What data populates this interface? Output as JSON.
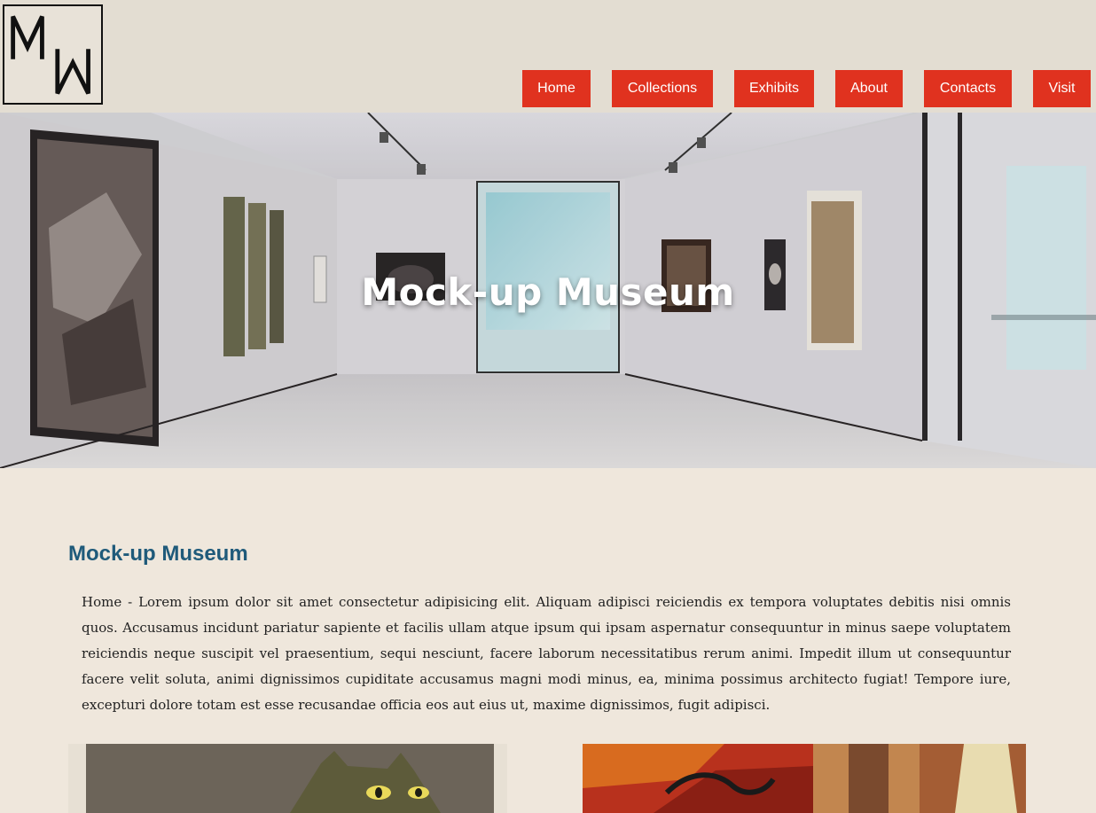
{
  "logo": {
    "letters": "MW",
    "icon": "mw-monogram-logo"
  },
  "nav": {
    "items": [
      {
        "label": "Home"
      },
      {
        "label": "Collections"
      },
      {
        "label": "Exhibits"
      },
      {
        "label": "About"
      },
      {
        "label": "Contacts"
      },
      {
        "label": "Visit"
      }
    ]
  },
  "hero": {
    "title": "Mock-up Museum"
  },
  "main": {
    "title": "Mock-up Museum",
    "intro": "Home - Lorem ipsum dolor sit amet consectetur adipisicing elit. Aliquam adipisci reiciendis ex tempora voluptates debitis nisi omnis quos. Accusamus incidunt pariatur sapiente et facilis ullam atque ipsum qui ipsam aspernatur consequuntur in minus saepe voluptatem reiciendis neque suscipit vel praesentium, sequi nesciunt, facere laborum necessitatibus rerum animi. Impedit illum ut consequuntur facere velit soluta, animi dignissimos cupiditate accusamus magni modi minus, ea, minima possimus architecto fugiat! Tempore iure, excepturi dolore totam est esse recusandae officia eos aut eius ut, maxime dignissimos, fugit adipisci."
  },
  "colors": {
    "accent": "#e0321f",
    "heading": "#1f5a7a",
    "background": "#efe7dc",
    "header": "#e3ddd2"
  }
}
